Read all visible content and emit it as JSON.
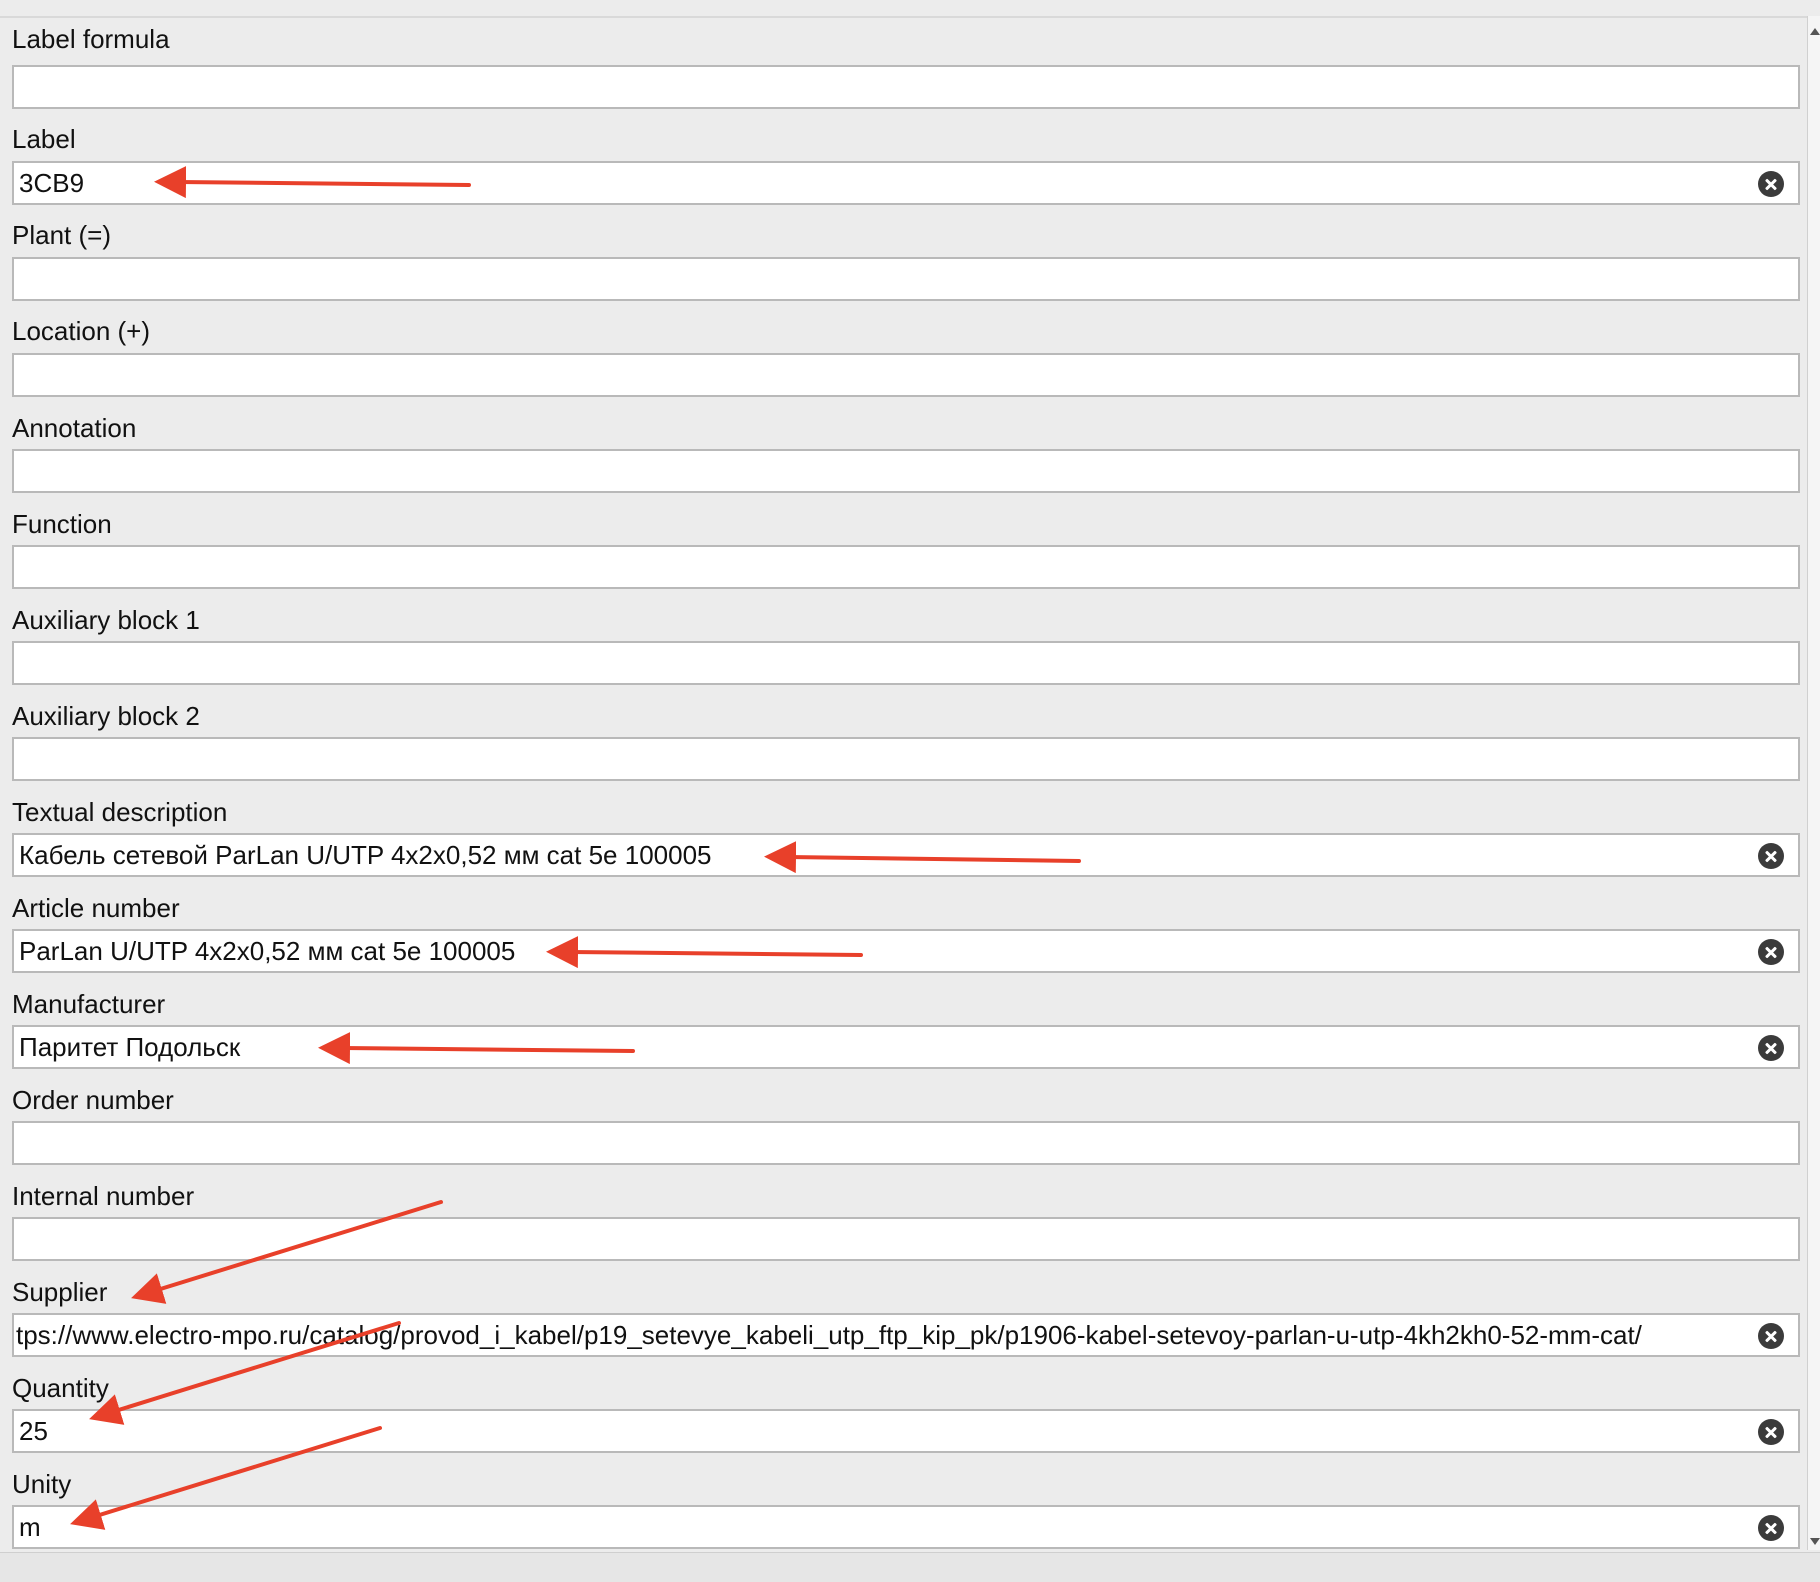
{
  "fields": [
    {
      "label": "Label formula",
      "value": ""
    },
    {
      "label": "Label",
      "value": "3CB9"
    },
    {
      "label": "Plant (=)",
      "value": ""
    },
    {
      "label": "Location (+)",
      "value": ""
    },
    {
      "label": "Annotation",
      "value": ""
    },
    {
      "label": "Function",
      "value": ""
    },
    {
      "label": "Auxiliary block 1",
      "value": ""
    },
    {
      "label": "Auxiliary block 2",
      "value": ""
    },
    {
      "label": "Textual description",
      "value": "Кабель сетевой ParLan U/UTP 4x2x0,52 мм cat 5e 100005"
    },
    {
      "label": "Article number",
      "value": "ParLan U/UTP 4x2x0,52 мм cat 5e 100005"
    },
    {
      "label": "Manufacturer",
      "value": "Паритет Подольск"
    },
    {
      "label": "Order number",
      "value": ""
    },
    {
      "label": "Internal number",
      "value": ""
    },
    {
      "label": "Supplier",
      "value": "tps://www.electro-mpo.ru/catalog/provod_i_kabel/p19_setevye_kabeli_utp_ftp_kip_pk/p1906-kabel-setevoy-parlan-u-utp-4kh2kh0-52-mm-cat/"
    },
    {
      "label": "Quantity",
      "value": "25"
    },
    {
      "label": "Unity",
      "value": "m"
    }
  ],
  "icons": {
    "clear": "clear-icon",
    "scroll_up": "scroll-up-arrow-icon",
    "scroll_down": "scroll-down-arrow-icon"
  },
  "colors": {
    "background": "#ececec",
    "field_background": "#ffffff",
    "field_border": "#b9b9b9",
    "annotation_arrow": "#e8402a",
    "clear_icon": "#3b3b3b"
  }
}
